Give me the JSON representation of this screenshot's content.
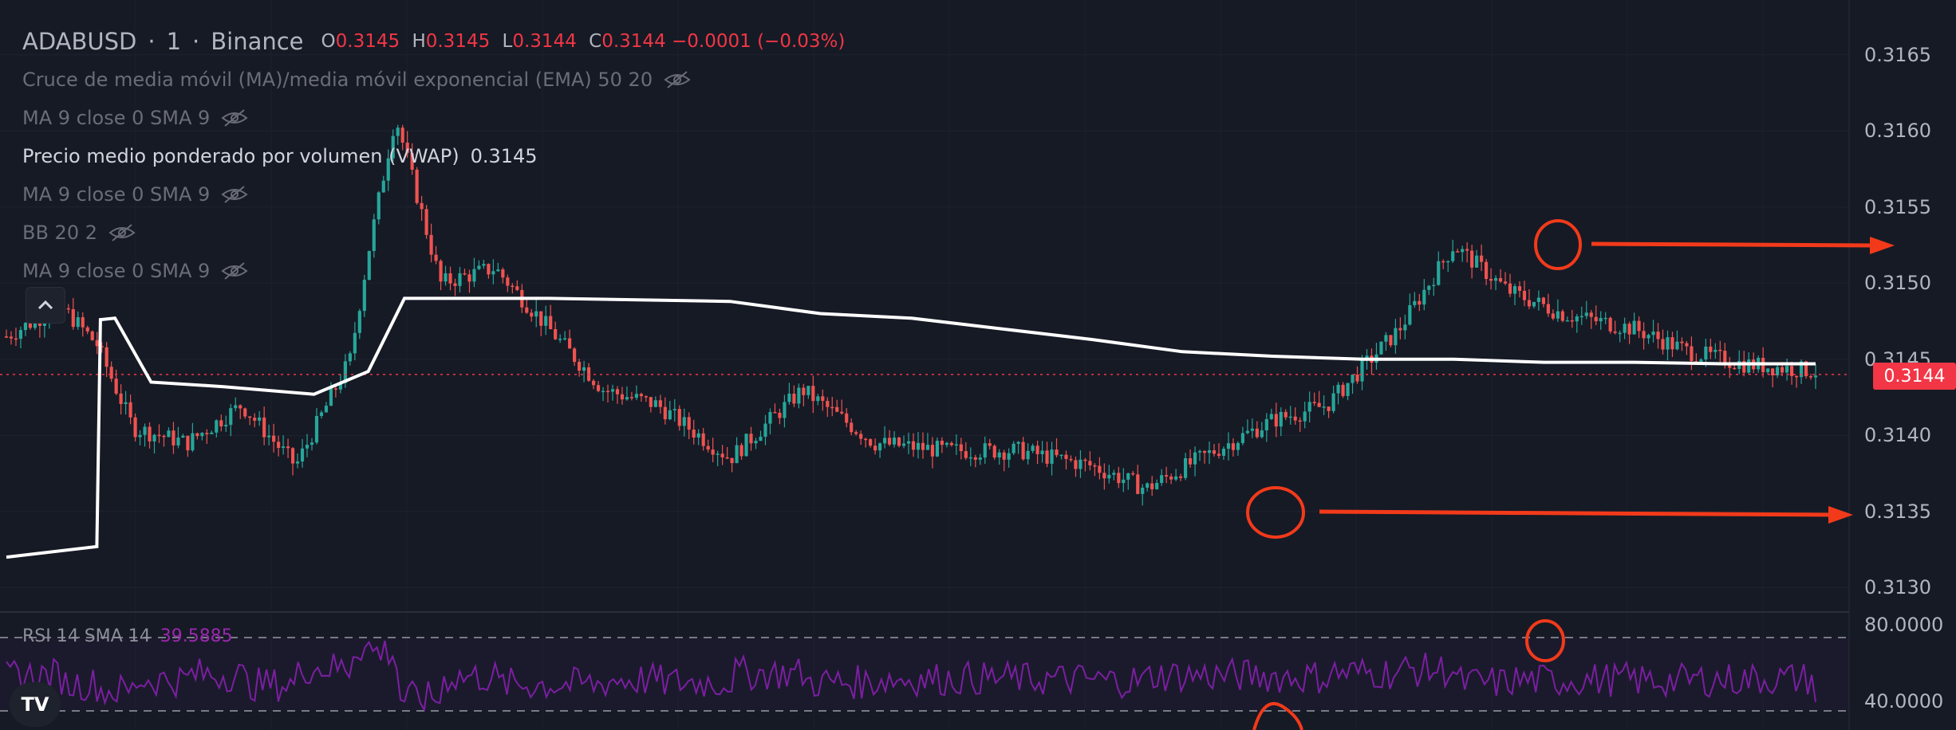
{
  "header": {
    "symbol": "ADABUSD",
    "interval": "1",
    "exchange": "Binance",
    "sep": "·",
    "open_label": "O",
    "open": "0.3145",
    "high_label": "H",
    "high": "0.3145",
    "low_label": "L",
    "low": "0.3144",
    "close_label": "C",
    "close": "0.3144",
    "change": "−0.0001 (−0.03%)"
  },
  "indicators": [
    {
      "label": "Cruce de media móvil (MA)/media móvil exponencial (EMA) 50 20",
      "visible": false
    },
    {
      "label": "MA 9 close 0 SMA 9",
      "visible": false
    },
    {
      "label": "Precio medio ponderado por volumen (VWAP)",
      "visible": true,
      "value": "0.3145"
    },
    {
      "label": "MA 9 close 0 SMA 9",
      "visible": false
    },
    {
      "label": "BB 20 2",
      "visible": false
    },
    {
      "label": "MA 9 close 0 SMA 9",
      "visible": false
    }
  ],
  "rsi_legend": {
    "label": "RSI 14 SMA 14",
    "value": "39.5885"
  },
  "price_tag": "0.3144",
  "collapse_icon": "chevron-up-icon",
  "logo": "TV",
  "colors": {
    "background": "#161a25",
    "up": "#26a69a",
    "down": "#ef5350",
    "vwap": "#ffffff",
    "rsi": "#7b1fa2",
    "annotation": "#f23a1a",
    "price_line": "#f23645"
  },
  "chart_data": {
    "type": "candlestick",
    "symbol": "ADABUSD",
    "interval": "1",
    "ylim": [
      0.31285,
      0.31686
    ],
    "yticks": [
      "0.3165",
      "0.3160",
      "0.3155",
      "0.3150",
      "0.3145",
      "0.3140",
      "0.3135",
      "0.3130"
    ],
    "current_price": 0.3144,
    "vwap": {
      "x": [
        0,
        0.05,
        0.052,
        0.06,
        0.08,
        0.12,
        0.17,
        0.2,
        0.22,
        0.3,
        0.4,
        0.45,
        0.5,
        0.55,
        0.6,
        0.65,
        0.7,
        0.75,
        0.8,
        0.85,
        0.9,
        0.95,
        1.0
      ],
      "y": [
        0.3132,
        0.31327,
        0.31476,
        0.31477,
        0.31435,
        0.31432,
        0.31427,
        0.31442,
        0.3149,
        0.3149,
        0.31488,
        0.3148,
        0.31477,
        0.3147,
        0.31463,
        0.31455,
        0.31452,
        0.3145,
        0.3145,
        0.31448,
        0.31448,
        0.31447,
        0.31447
      ]
    },
    "price_path": {
      "x": [
        0,
        0.03,
        0.05,
        0.07,
        0.1,
        0.13,
        0.16,
        0.19,
        0.2,
        0.215,
        0.24,
        0.27,
        0.3,
        0.33,
        0.36,
        0.4,
        0.44,
        0.48,
        0.52,
        0.56,
        0.6,
        0.63,
        0.66,
        0.7,
        0.73,
        0.77,
        0.8,
        0.83,
        0.86,
        0.9,
        0.93,
        0.96,
        1.0
      ],
      "y": [
        0.31465,
        0.31485,
        0.3146,
        0.31405,
        0.31395,
        0.3142,
        0.3138,
        0.3145,
        0.3152,
        0.3161,
        0.315,
        0.3151,
        0.3147,
        0.3143,
        0.3142,
        0.31385,
        0.3143,
        0.31395,
        0.3139,
        0.3139,
        0.3138,
        0.31365,
        0.31385,
        0.3141,
        0.3142,
        0.3147,
        0.31525,
        0.31495,
        0.3148,
        0.3147,
        0.31455,
        0.31447,
        0.31442
      ]
    },
    "rsi": {
      "name": "RSI 14 SMA 14",
      "ylim": [
        30,
        85
      ],
      "levels": [
        70,
        30
      ],
      "ticks": [
        "80.0000",
        "40.0000"
      ],
      "last": 39.5885
    }
  }
}
